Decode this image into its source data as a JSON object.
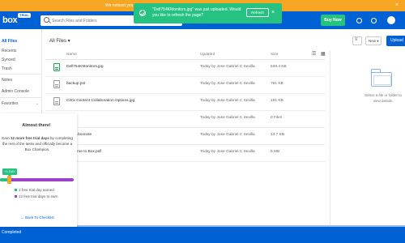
{
  "trial_banner": {
    "text": "We noticed you have 12 days left in your free trial.",
    "close": "×"
  },
  "header": {
    "logo": "box",
    "logo_badge": "TRIAL",
    "search_placeholder": "Search Files and Folders",
    "buy_now": "Buy Now"
  },
  "toast": {
    "message": "\"Dell754KMonitors.jpg\" was just uploaded. Would you like to refresh the page?",
    "refresh": "Refresh",
    "close": "×"
  },
  "sidebar": {
    "items": [
      {
        "label": "All Files",
        "active": true
      },
      {
        "label": "Recents"
      },
      {
        "label": "Synced"
      },
      {
        "label": "Trash"
      },
      {
        "label": "Notes"
      },
      {
        "label": "Admin Console"
      },
      {
        "label": "Favorites"
      }
    ]
  },
  "onboarding": {
    "title": "Almost there!",
    "desc_before": "Earn ",
    "desc_bold": "12 more free trial days",
    "desc_after": " by completing the rest of the tasks and officially become a Box Champion.",
    "day_tag": "+1 DAY",
    "progress_fraction": 0.11,
    "legend": [
      {
        "label": "1 free trial day earned",
        "color": "#26c281"
      },
      {
        "label": "12 free trial days to earn",
        "color": "#9b42c9"
      }
    ],
    "back_link": "← Back To Checklist"
  },
  "main": {
    "breadcrumb": "All Files ▾",
    "columns": {
      "name": "Name",
      "updated": "Updated",
      "size": "Size"
    },
    "rows": [
      {
        "icon": "image-file-icon",
        "name": "Dell754KMonitors.jpg",
        "updated": "Today by Jose Gabriel C Sevilla",
        "size": "538.4 KB"
      },
      {
        "icon": "document-file-icon",
        "name": "backup.pst",
        "updated": "Today by Jose Gabriel C Sevilla",
        "size": "761 KB"
      },
      {
        "icon": "document-file-icon",
        "name": "Citrix Content Collaboration Options.jpg",
        "updated": "Today by Jose Gabriel C Sevilla",
        "size": "191 KB"
      },
      {
        "icon": "document-file-icon",
        "name": "Notes",
        "updated": "Today by Jose Gabriel C Sevilla",
        "size": "0 Files"
      },
      {
        "icon": "document-file-icon",
        "name": "Guide.boxnote",
        "updated": "Today by Jose Gabriel C Sevilla",
        "size": "13.7 KB"
      },
      {
        "icon": "document-file-icon",
        "name": "Welcome to Box.pdf",
        "updated": "Today by Jose Gabriel C Sevilla",
        "size": "5 MB"
      }
    ]
  },
  "toolbar": {
    "new": "New ▾",
    "upload": "Upload"
  },
  "details": {
    "text": "Select a file or folder to view details."
  },
  "upload_bar": {
    "status": "Completed",
    "progress_fraction": 1.0
  }
}
